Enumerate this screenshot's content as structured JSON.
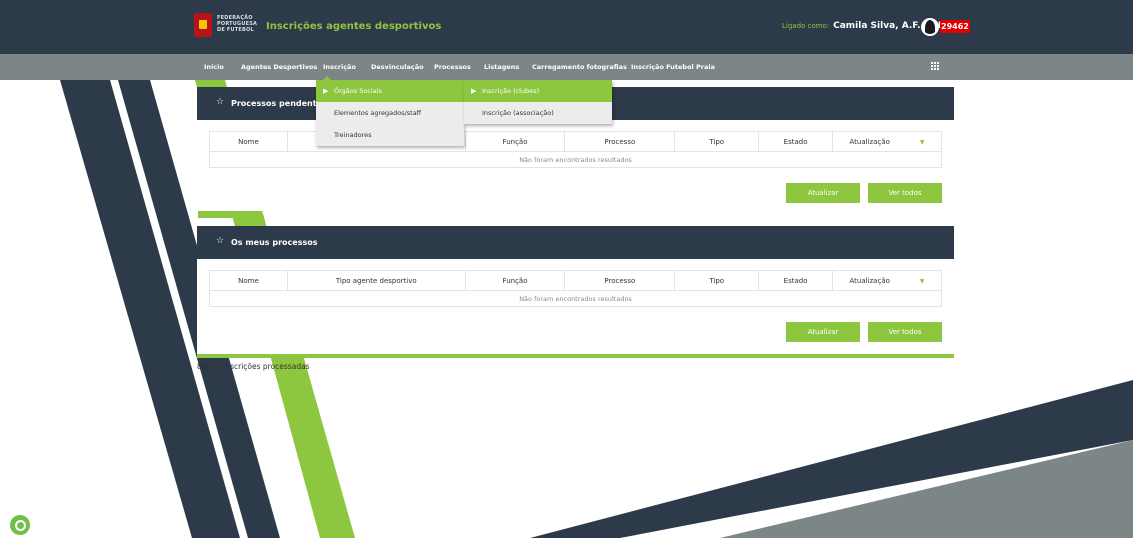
{
  "header": {
    "federation_lines": [
      "FEDERAÇÃO",
      "PORTUGUESA",
      "DE FUTEBOL"
    ],
    "app_title": "Inscrições agentes desportivos",
    "logged_label": "Ligado como:",
    "user": "Camila Silva, A.F. PORTO",
    "badge": "29462"
  },
  "nav": {
    "items": [
      "Início",
      "Agentes Desportivos",
      "Inscrição",
      "Desvinculação",
      "Processos",
      "Listagens",
      "Carregamento fotografias",
      "Inscrição Futebol Praia"
    ]
  },
  "menu": {
    "level1": [
      "Órgãos Sociais",
      "Elementos agregados/staff",
      "Treinadores"
    ],
    "level2": [
      "Inscrição (clubes)",
      "Inscrição (associação)"
    ]
  },
  "panels": [
    {
      "title": "Processos pendentes",
      "columns": [
        "Nome",
        "Tipo agente desportivo",
        "Função",
        "Processo",
        "Tipo",
        "Estado",
        "Atualização"
      ],
      "empty_text": "Não foram encontrados resultados",
      "buttons": [
        "Atualizar",
        "Ver todos"
      ]
    },
    {
      "title": "Os meus processos",
      "columns": [
        "Nome",
        "Tipo agente desportivo",
        "Função",
        "Processo",
        "Tipo",
        "Estado",
        "Atualização"
      ],
      "empty_text": "Não foram encontrados resultados",
      "buttons": [
        "Atualizar",
        "Ver todos"
      ]
    }
  ],
  "footer": {
    "counter": "88925 inscrições processadas"
  },
  "colors": {
    "navy": "#2d3a4a",
    "green": "#8dc63f",
    "gray_nav": "#7c8686",
    "badge_red": "#e00000"
  }
}
